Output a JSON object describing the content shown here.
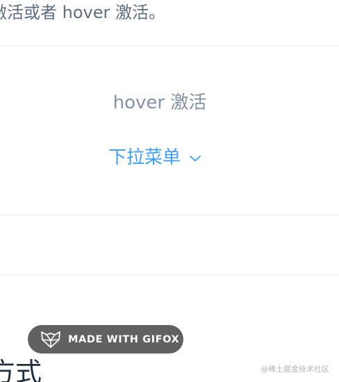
{
  "intro": {
    "text": "激活或者 hover 激活。"
  },
  "demo": {
    "hover_label": "hover 激活",
    "dropdown": {
      "label": "下拉菜单",
      "icon": "chevron-down-icon"
    }
  },
  "badge": {
    "icon": "gifox-fox-icon",
    "text": "MADE WITH GIFOX"
  },
  "section": {
    "heading": "方式"
  },
  "watermark": {
    "text": "@稀土掘金技术社区"
  },
  "colors": {
    "accent": "#409eff",
    "muted_text": "#8492a6",
    "body_text": "#5e6d82",
    "border": "#ebebeb",
    "badge_bg": "#616161"
  }
}
